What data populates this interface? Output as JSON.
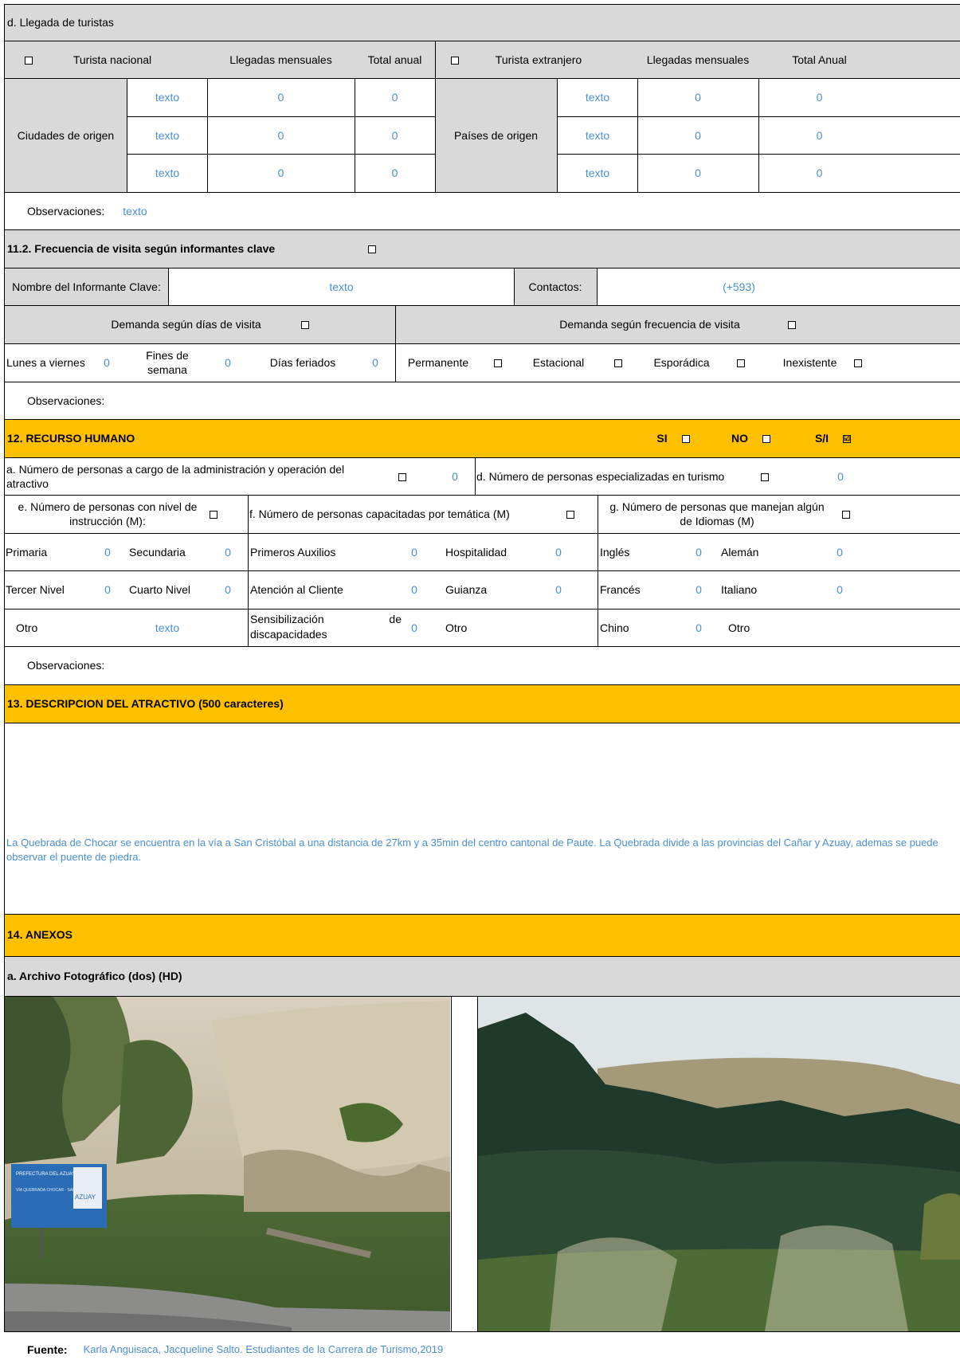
{
  "llegada": {
    "title": "d. Llegada de turistas",
    "nacional_label": "Turista nacional",
    "llegadas_mensuales": "Llegadas mensuales",
    "total_anual": "Total anual",
    "extranjero_label": "Turista extranjero",
    "llegadas_mensuales_ext": "Llegadas mensuales",
    "total_anual_ext": "Total Anual",
    "ciudades_label": "Ciudades de origen",
    "paises_label": "Países de origen",
    "rows": [
      {
        "ciudad": "texto",
        "mensual": "0",
        "anual": "0",
        "pais": "texto",
        "mensual_ext": "0",
        "anual_ext": "0"
      },
      {
        "ciudad": "texto",
        "mensual": "0",
        "anual": "0",
        "pais": "texto",
        "mensual_ext": "0",
        "anual_ext": "0"
      },
      {
        "ciudad": "texto",
        "mensual": "0",
        "anual": "0",
        "pais": "texto",
        "mensual_ext": "0",
        "anual_ext": "0"
      }
    ],
    "obs_label": "Observaciones:",
    "obs_value": "texto"
  },
  "frecuencia": {
    "title": "11.2. Frecuencia de visita según informantes clave",
    "informante_label": "Nombre del Informante Clave:",
    "informante_value": "texto",
    "contactos_label": "Contactos:",
    "contactos_value": "(+593)",
    "demanda_dias": "Demanda según  días de visita",
    "demanda_frec": "Demanda según frecuencia de visita",
    "lunes_label": "Lunes a viernes",
    "lunes_value": "0",
    "fines_label": "Fines de semana",
    "fines_value": "0",
    "feriados_label": "Días feriados",
    "feriados_value": "0",
    "permanente": "Permanente",
    "estacional": "Estacional",
    "esporadica": "Esporádica",
    "inexistente": "Inexistente",
    "obs_label": "Observaciones:"
  },
  "recurso": {
    "title": "12. RECURSO HUMANO",
    "si": "SI",
    "no": "NO",
    "si_no": "S/I",
    "check_mark": "☑",
    "a_label": "a. Número de personas a cargo de la administración y operación del atractivo",
    "a_value": "0",
    "d_label": "d. Número de personas especializadas en turismo",
    "d_value": "0",
    "e_label": "e. Número de personas con nivel de instrucción (M):",
    "f_label": "f. Número de personas capacitadas por temática (M)",
    "g_label": "g. Número de personas que manejan algún de Idiomas (M)",
    "primaria": "Primaria",
    "primaria_v": "0",
    "secundaria": "Secundaria",
    "secundaria_v": "0",
    "tercer": "Tercer Nivel",
    "tercer_v": "0",
    "cuarto": "Cuarto Nivel",
    "cuarto_v": "0",
    "otro_e": "Otro",
    "otro_e_v": "texto",
    "primeros": "Primeros Auxilios",
    "primeros_v": "0",
    "hospitalidad": "Hospitalidad",
    "hospitalidad_v": "0",
    "atencion": "Atención al Cliente",
    "atencion_v": "0",
    "guianza": "Guianza",
    "guianza_v": "0",
    "sensib_1": "Sensibilización",
    "sensib_de": "de",
    "sensib_2": "discapacidades",
    "sensib_v": "0",
    "otro_f": "Otro",
    "ingles": "Inglés",
    "ingles_v": "0",
    "aleman": "Alemán",
    "aleman_v": "0",
    "frances": "Francés",
    "frances_v": "0",
    "italiano": "Italiano",
    "italiano_v": "0",
    "chino": "Chino",
    "chino_v": "0",
    "otro_g": "Otro",
    "obs_label": "Observaciones:"
  },
  "descripcion": {
    "title": "13. DESCRIPCION DEL ATRACTIVO (500 caracteres)",
    "text": "La Quebrada de Chocar se encuentra en la vía a San Cristóbal a una distancia de 27km y a 35min del centro cantonal de Paute. La Quebrada divide a las provincias del Cañar y Azuay, ademas se puede observar el puente de piedra."
  },
  "anexos": {
    "title": "14. ANEXOS",
    "archivo": "a. Archivo Fotográfico (dos) (HD)",
    "sign_1": "PREFECTURA DEL AZUAY",
    "sign_2": "VÍA QUEBRADA CHOCAR - SAN CRISTÓBAL",
    "sign_logo": "AZUAY",
    "fuente_label": "Fuente:",
    "fuente_value": "Karla Anguisaca, Jacqueline Salto. Estudiantes de la Carrera de Turismo,2019"
  },
  "colors": {
    "gold": "#ffc000",
    "gray": "#d9d9d9",
    "blue": "#4a8fd6"
  }
}
